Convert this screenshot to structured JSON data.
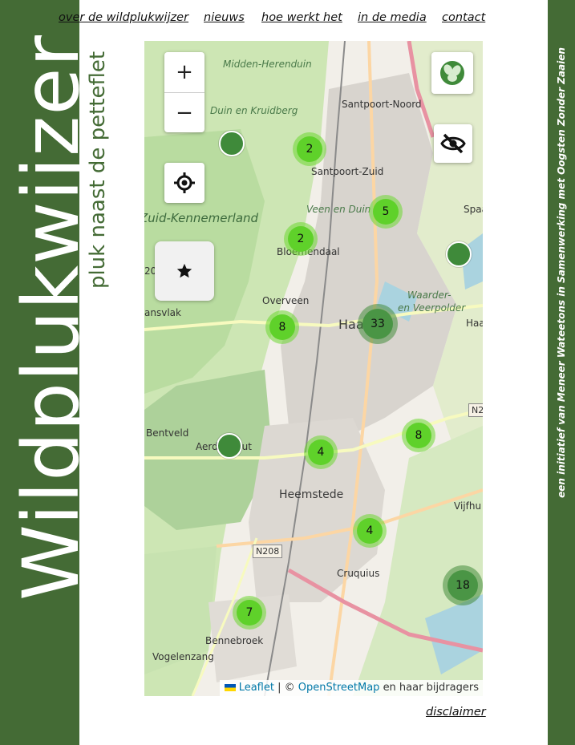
{
  "brand": {
    "title": "Wildplukwijzer",
    "subtitle": "pluk naast de petteflet",
    "credit": "een initiatief van Meneer Wateetons in Samenwerking met Oogsten Zonder Zaaien"
  },
  "nav": {
    "items": [
      "over de wildplukwijzer",
      "nieuws",
      "hoe werkt het",
      "in de media",
      "contact"
    ]
  },
  "map": {
    "controls": {
      "zoom_in": "+",
      "zoom_out": "−"
    },
    "clusters": [
      {
        "count": "2"
      },
      {
        "count": "5"
      },
      {
        "count": "2"
      },
      {
        "count": "8"
      },
      {
        "count": "33"
      },
      {
        "count": "8"
      },
      {
        "count": "4"
      },
      {
        "count": "4"
      },
      {
        "count": "18"
      },
      {
        "count": "7"
      }
    ],
    "labels": {
      "midden_herenduin": "Midden-Herenduin",
      "duin_en_kruidberg": "Duin en Kruidberg",
      "santpoort_noord": "Santpoort-Noord",
      "santpoort_zuid": "Santpoort-Zuid",
      "zuid_kennemerland": "Zuid-Kennemerland",
      "veen_en_duin": "Veen en Duin",
      "bloemendaal": "Bloemendaal",
      "overveen": "Overveen",
      "haarlem": "Haa",
      "spaarndam": "Spaa",
      "waarder": "Waarder-",
      "veerpolder": "en Veerpolder",
      "haarlem_right": "Haa",
      "bentveld": "Bentveld",
      "aerdenhout": "Aerdenhout",
      "heemstede": "Heemstede",
      "vijfhuizen": "Vijfhu",
      "cruquius": "Cruquius",
      "bennebroek": "Bennebroek",
      "vogelenzang": "Vogelenzang",
      "road_n208": "N208",
      "road_n2": "N2",
      "num_20": "20",
      "ansvlak": "ansvlak"
    },
    "attribution": {
      "leaflet": "Leaflet",
      "separator": "| ©",
      "osm": "OpenStreetMap",
      "suffix": "en haar bijdragers"
    }
  },
  "footer": {
    "disclaimer": "disclaimer"
  },
  "colors": {
    "brand_green": "#446b35",
    "cluster_small": "#5fd12a",
    "cluster_large": "#4a9545"
  }
}
